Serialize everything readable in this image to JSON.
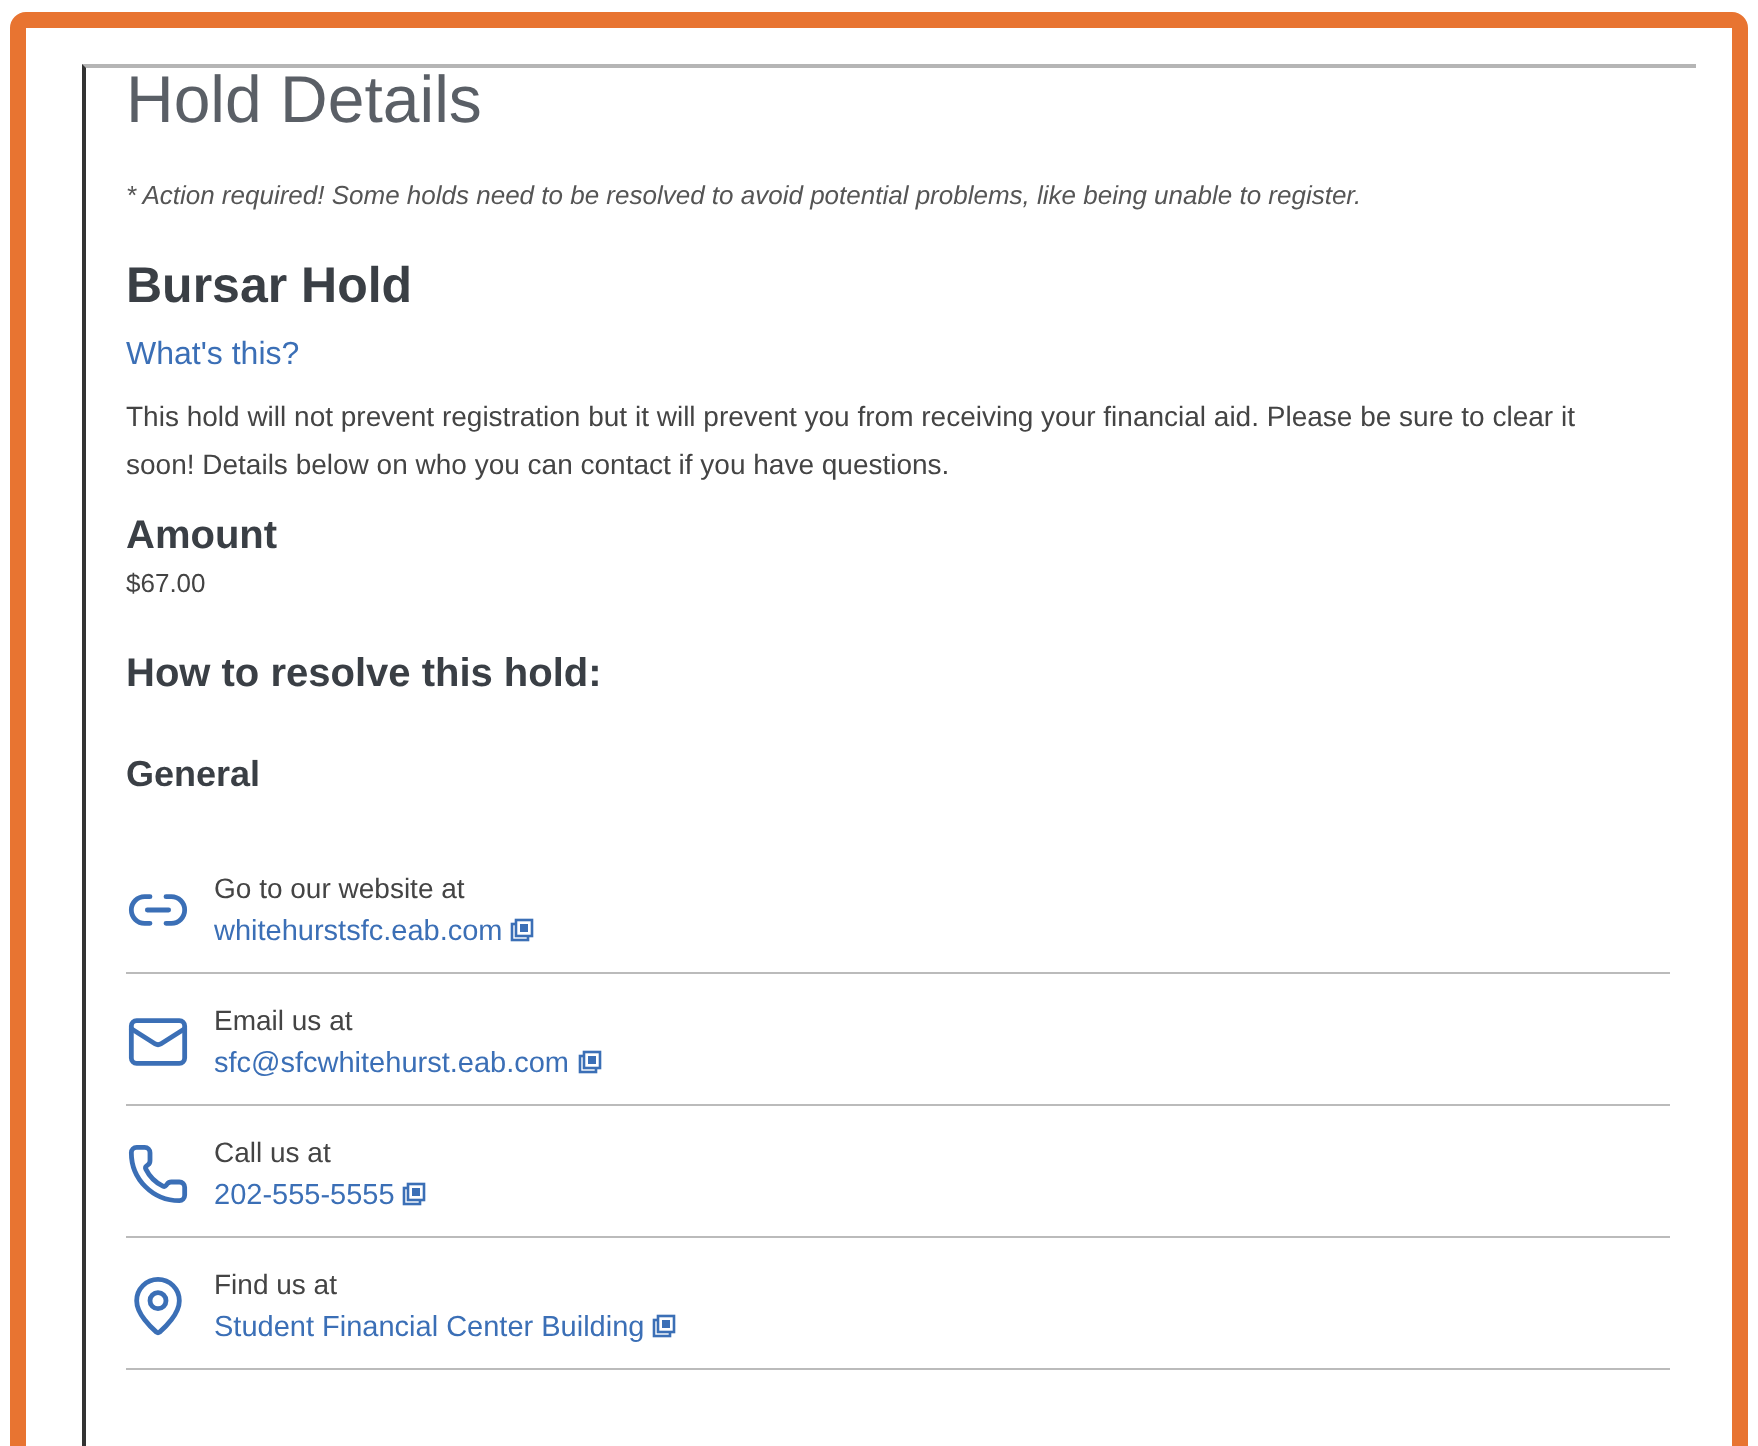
{
  "title": "Hold Details",
  "notice": "* Action required! Some holds need to be resolved to avoid potential problems, like being unable to register.",
  "hold": {
    "name": "Bursar Hold",
    "help_link": "What's this?",
    "description": "This hold will not prevent registration but it will prevent you from receiving your financial aid. Please be sure to clear it soon! Details below on who you can contact if you have questions.",
    "amount_label": "Amount",
    "amount": "$67.00"
  },
  "resolve_heading": "How to resolve this hold:",
  "section": "General",
  "contacts": [
    {
      "kind": "website",
      "label": "Go to our website at",
      "link": "whitehurstsfc.eab.com"
    },
    {
      "kind": "email",
      "label": "Email us at",
      "link": "sfc@sfcwhitehurst.eab.com"
    },
    {
      "kind": "phone",
      "label": "Call us at",
      "link": "202-555-5555"
    },
    {
      "kind": "location",
      "label": "Find us at",
      "link": "Student Financial Center Building"
    }
  ]
}
